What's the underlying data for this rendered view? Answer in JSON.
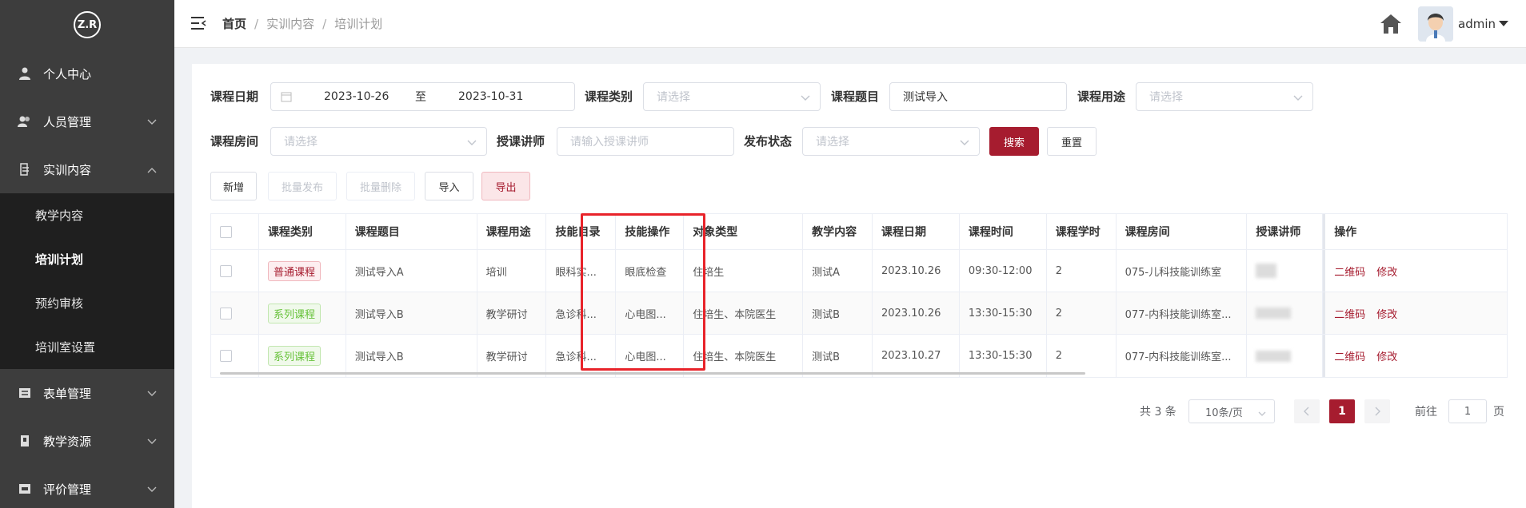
{
  "sidebar": {
    "logo": "Z.R",
    "items": [
      {
        "label": "个人中心"
      },
      {
        "label": "人员管理"
      },
      {
        "label": "实训内容"
      },
      {
        "label": "表单管理"
      },
      {
        "label": "教学资源"
      },
      {
        "label": "评价管理"
      }
    ],
    "sub_items": [
      {
        "label": "教学内容"
      },
      {
        "label": "培训计划"
      },
      {
        "label": "预约审核"
      },
      {
        "label": "培训室设置"
      }
    ]
  },
  "header": {
    "breadcrumb": [
      "首页",
      "实训内容",
      "培训计划"
    ],
    "separator": "/",
    "username": "admin"
  },
  "filters": {
    "date_label": "课程日期",
    "date_start": "2023-10-26",
    "date_to": "至",
    "date_end": "2023-10-31",
    "category_label": "课程类别",
    "category_placeholder": "请选择",
    "topic_label": "课程题目",
    "topic_value": "测试导入",
    "purpose_label": "课程用途",
    "purpose_placeholder": "请选择",
    "room_label": "课程房间",
    "room_placeholder": "请选择",
    "teacher_label": "授课讲师",
    "teacher_placeholder": "请输入授课讲师",
    "status_label": "发布状态",
    "status_placeholder": "请选择",
    "search_btn": "搜索",
    "reset_btn": "重置"
  },
  "toolbar": {
    "add": "新增",
    "batch_publish": "批量发布",
    "batch_delete": "批量删除",
    "import": "导入",
    "export": "导出"
  },
  "table": {
    "headers": [
      "课程类别",
      "课程题目",
      "课程用途",
      "技能目录",
      "技能操作",
      "对象类型",
      "教学内容",
      "课程日期",
      "课程时间",
      "课程学时",
      "课程房间",
      "授课讲师",
      "操作"
    ],
    "rows": [
      {
        "category": "普通课程",
        "category_kind": "red",
        "topic": "测试导入A",
        "purpose": "培训",
        "skill_dir": "眼科实...",
        "skill_op": "眼底检查",
        "target": "住培生",
        "content": "测试A",
        "date": "2023.10.26",
        "time": "09:30-12:00",
        "hours": "2",
        "room": "075-儿科技能训练室",
        "qr": "二维码",
        "edit": "修改"
      },
      {
        "category": "系列课程",
        "category_kind": "green",
        "topic": "测试导入B",
        "purpose": "教学研讨",
        "skill_dir": "急诊科...",
        "skill_op": "心电图...",
        "target": "住培生、本院医生",
        "content": "测试B",
        "date": "2023.10.26",
        "time": "13:30-15:30",
        "hours": "2",
        "room": "077-内科技能训练室...",
        "qr": "二维码",
        "edit": "修改"
      },
      {
        "category": "系列课程",
        "category_kind": "green",
        "topic": "测试导入B",
        "purpose": "教学研讨",
        "skill_dir": "急诊科...",
        "skill_op": "心电图...",
        "target": "住培生、本院医生",
        "content": "测试B",
        "date": "2023.10.27",
        "time": "13:30-15:30",
        "hours": "2",
        "room": "077-内科技能训练室...",
        "qr": "二维码",
        "edit": "修改"
      }
    ]
  },
  "pagination": {
    "total": "共 3 条",
    "page_size": "10条/页",
    "current": "1",
    "goto_label": "前往",
    "goto_value": "1",
    "page_suffix": "页"
  },
  "colors": {
    "accent": "#a61c2f",
    "sidebar": "#3d3d3d",
    "highlight": "#e8232a"
  }
}
